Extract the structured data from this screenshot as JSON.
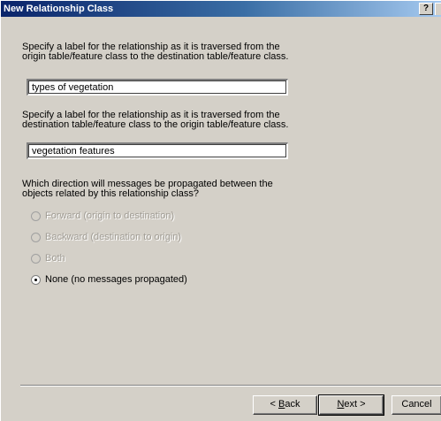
{
  "window": {
    "title": "New Relationship Class",
    "help_label": "?"
  },
  "forward_section": {
    "description": "Specify a label for the relationship as it is traversed from the origin table/feature class to the destination table/feature class.",
    "value": "types of vegetation"
  },
  "backward_section": {
    "description": "Specify a label for the relationship as it is traversed from the destination table/feature class to the origin table/feature class.",
    "value": "vegetation features"
  },
  "propagation": {
    "question": "Which direction will messages be propagated between the objects related by this relationship class?",
    "options": [
      {
        "label": "Forward (origin to destination)",
        "enabled": false,
        "selected": false
      },
      {
        "label": "Backward (destination to origin)",
        "enabled": false,
        "selected": false
      },
      {
        "label": "Both",
        "enabled": false,
        "selected": false
      },
      {
        "label": "None (no messages propagated)",
        "enabled": true,
        "selected": true
      }
    ]
  },
  "buttons": {
    "back": {
      "prefix": "< ",
      "mnemonic": "B",
      "rest": "ack"
    },
    "next": {
      "prefix": "",
      "mnemonic": "N",
      "rest": "ext >"
    },
    "cancel": "Cancel"
  }
}
